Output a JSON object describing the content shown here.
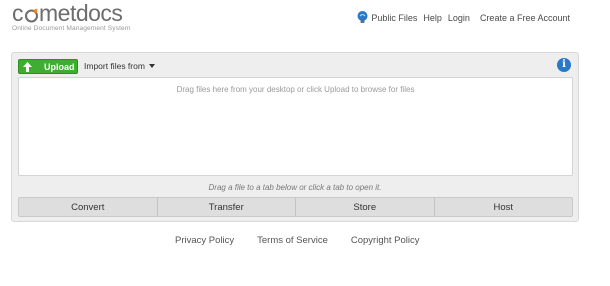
{
  "header": {
    "logo_text_pre": "c",
    "logo_text_post": "metdocs",
    "tagline": "Online Document Management System",
    "nav": {
      "public_files": "Public Files",
      "help": "Help",
      "login": "Login",
      "create_account": "Create a Free Account"
    }
  },
  "toolbar": {
    "upload_label": "Upload",
    "import_label": "Import files from"
  },
  "dropzone": {
    "text": "Drag files here from your desktop or click Upload to browse for files"
  },
  "drag_hint": "Drag a file to a tab below or click a tab to open it.",
  "tabs": [
    {
      "label": "Convert"
    },
    {
      "label": "Transfer"
    },
    {
      "label": "Store"
    },
    {
      "label": "Host"
    }
  ],
  "footer": {
    "privacy": "Privacy Policy",
    "terms": "Terms of Service",
    "copyright": "Copyright Policy"
  },
  "colors": {
    "accent_green": "#3fac32",
    "info_blue": "#2a79c9",
    "logo_orange": "#f0821e"
  },
  "icons": {
    "upload": "up-arrow-icon",
    "public_files": "lightbulb-icon",
    "info": "info-icon",
    "logo_o": "comet-icon"
  }
}
